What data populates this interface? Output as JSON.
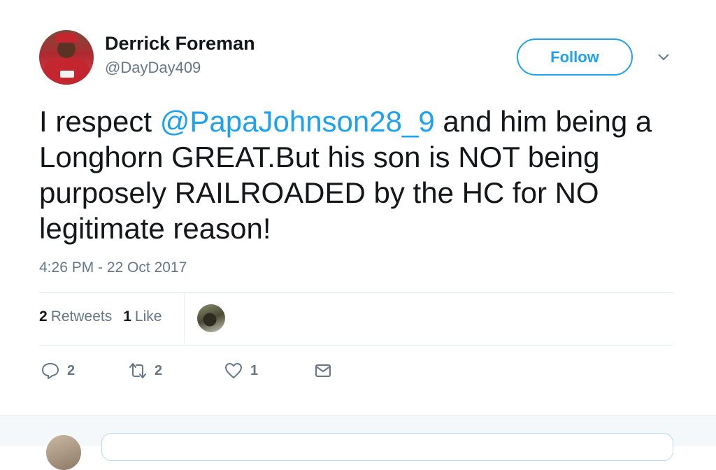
{
  "author": {
    "name": "Derrick Foreman",
    "handle": "@DayDay409"
  },
  "follow_label": "Follow",
  "tweet": {
    "text_before": "I respect ",
    "mention": "@PapaJohnson28_9",
    "text_after": " and him being a Longhorn GREAT.But his son is NOT being purposely RAILROADED by the HC for NO legitimate reason!",
    "timestamp": "4:26 PM - 22 Oct 2017"
  },
  "stats": {
    "retweets_count": "2",
    "retweets_label": "Retweets",
    "likes_count": "1",
    "likes_label": "Like"
  },
  "actions": {
    "reply_count": "2",
    "retweet_count": "2",
    "like_count": "1"
  },
  "colors": {
    "accent": "#1da1f2",
    "muted": "#657786",
    "text": "#14171a"
  },
  "icons": [
    "caret-down-icon",
    "reply-icon",
    "retweet-icon",
    "heart-icon",
    "message-icon"
  ]
}
